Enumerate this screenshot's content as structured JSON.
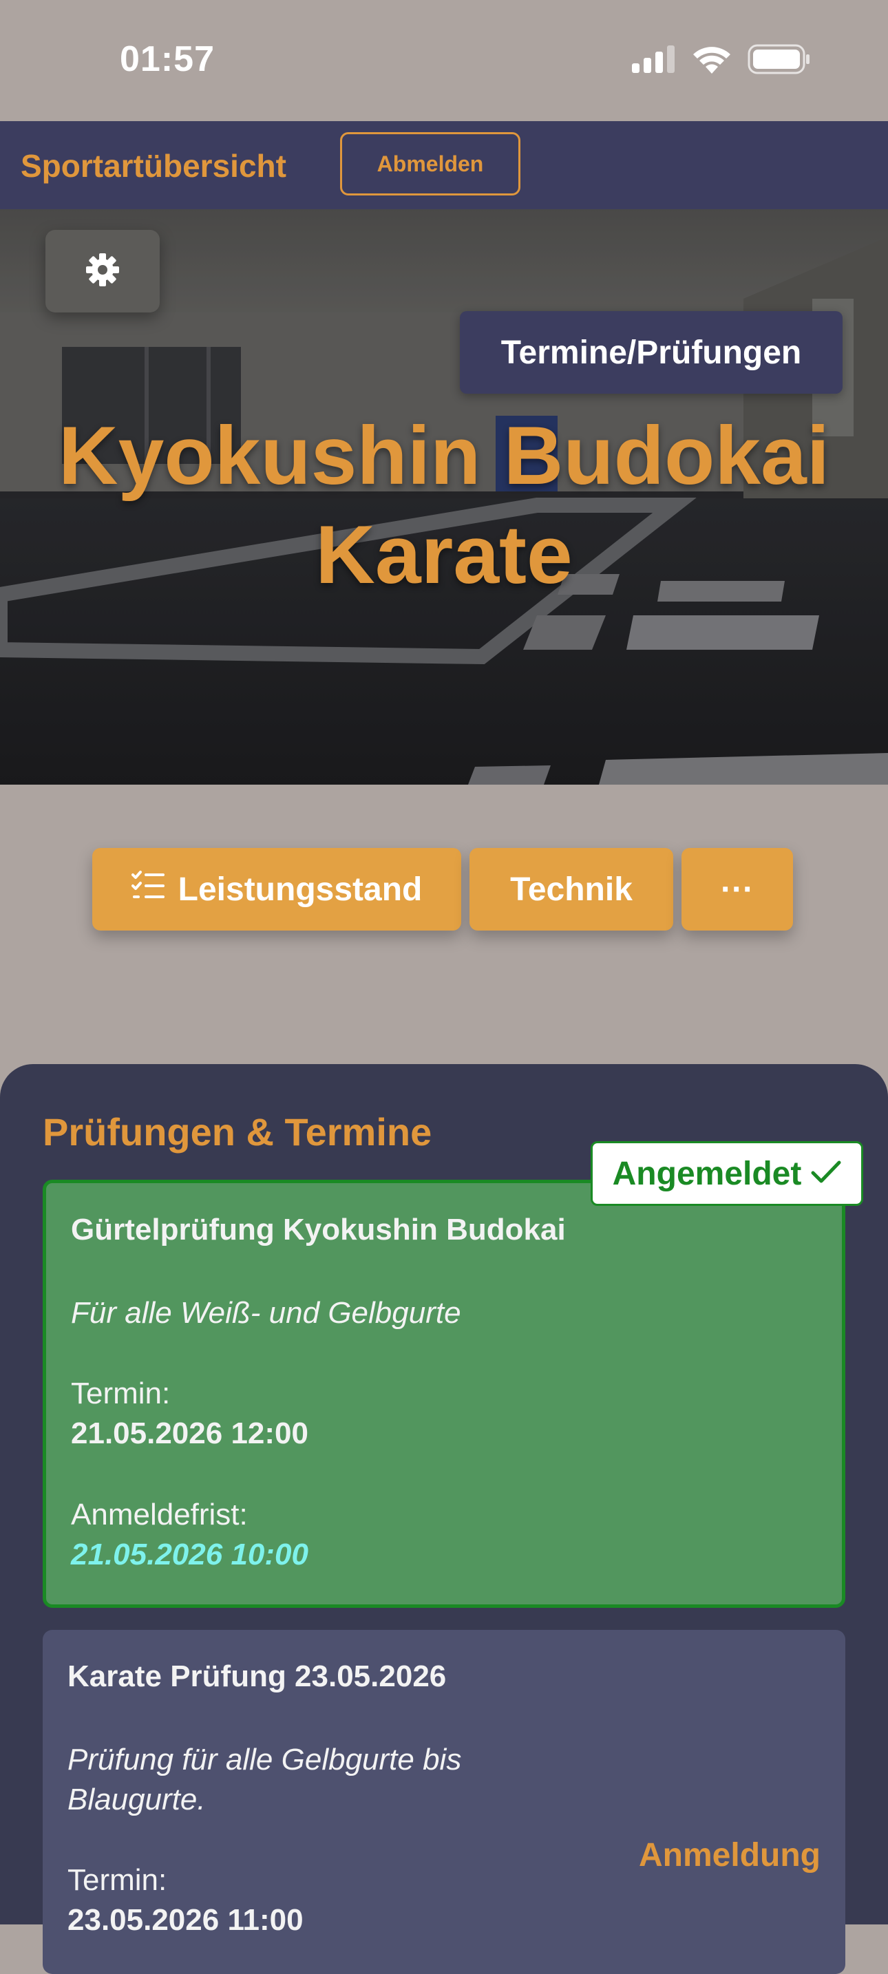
{
  "status_bar": {
    "time": "01:57"
  },
  "nav": {
    "title": "Sportartübersicht",
    "logout_label": "Abmelden"
  },
  "hero": {
    "termine_button": "Termine/Prüfungen",
    "title_line1": "Kyokushin Budokai",
    "title_line2": "Karate"
  },
  "actions": {
    "leistungsstand": "Leistungsstand",
    "technik": "Technik",
    "more": "···"
  },
  "panel": {
    "heading": "Prüfungen & Termine",
    "exams": [
      {
        "title": "Gürtelprüfung Kyokushin Budokai",
        "description": "Für alle Weiß- und Gelbgurte",
        "termin_label": "Termin:",
        "termin_value": "21.05.2026 12:00",
        "deadline_label": "Anmeldefrist:",
        "deadline_value": "21.05.2026 10:00",
        "status_badge": "Angemeldet",
        "status_color": "#1a8a24"
      },
      {
        "title": "Karate Prüfung 23.05.2026",
        "description_line1": "Prüfung für alle Gelbgurte bis",
        "description_line2": "Blaugurte.",
        "termin_label": "Termin:",
        "termin_value": "23.05.2026 11:00",
        "action_label": "Anmeldung"
      }
    ]
  },
  "colors": {
    "accent": "#e0973c",
    "nav_background": "#3c3d5f",
    "page_background": "#ada4a0",
    "panel_background": "#383a51"
  }
}
